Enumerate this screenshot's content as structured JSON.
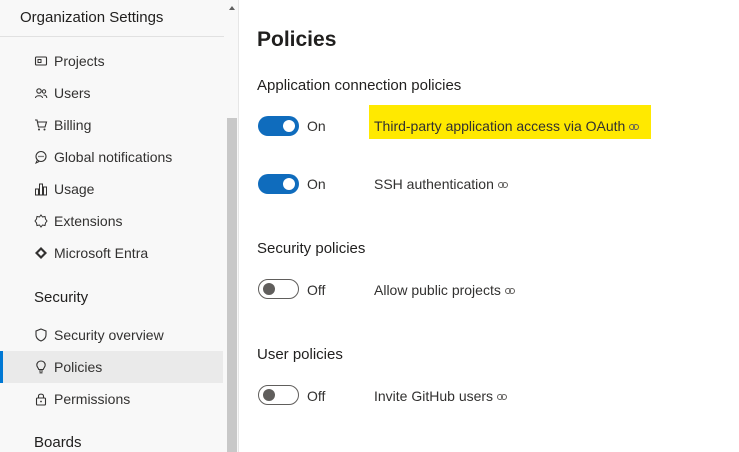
{
  "sidebar": {
    "title": "Organization Settings",
    "items_general": [
      {
        "label": "Projects",
        "icon": "projects-icon"
      },
      {
        "label": "Users",
        "icon": "users-icon"
      },
      {
        "label": "Billing",
        "icon": "cart-icon"
      },
      {
        "label": "Global notifications",
        "icon": "chat-icon"
      },
      {
        "label": "Usage",
        "icon": "chart-icon"
      },
      {
        "label": "Extensions",
        "icon": "gear-icon"
      },
      {
        "label": "Microsoft Entra",
        "icon": "entra-icon"
      }
    ],
    "security_heading": "Security",
    "items_security": [
      {
        "label": "Security overview",
        "icon": "shield-icon"
      },
      {
        "label": "Policies",
        "icon": "lightbulb-icon",
        "selected": true
      },
      {
        "label": "Permissions",
        "icon": "lock-icon"
      }
    ],
    "boards_heading": "Boards"
  },
  "main": {
    "page_title": "Policies",
    "groups": [
      {
        "title": "Application connection policies",
        "policies": [
          {
            "state": "On",
            "enabled": true,
            "label": "Third-party application access via OAuth",
            "highlighted": true
          },
          {
            "state": "On",
            "enabled": true,
            "label": "SSH authentication"
          }
        ]
      },
      {
        "title": "Security policies",
        "policies": [
          {
            "state": "Off",
            "enabled": false,
            "label": "Allow public projects"
          }
        ]
      },
      {
        "title": "User policies",
        "policies": [
          {
            "state": "Off",
            "enabled": false,
            "label": "Invite GitHub users"
          }
        ]
      }
    ]
  },
  "colors": {
    "accent": "#0f6cbd",
    "selected_bar": "#0078d4",
    "highlight": "#ffe900"
  }
}
